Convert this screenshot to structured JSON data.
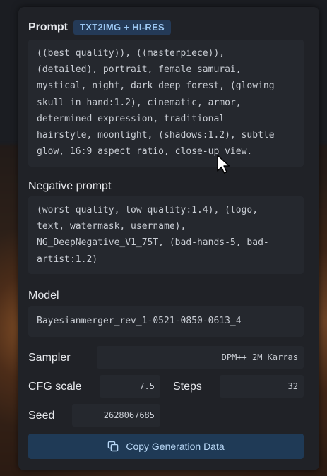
{
  "prompt": {
    "label": "Prompt",
    "badge": "TXT2IMG + HI-RES",
    "text": "((best quality)), ((masterpiece)),\n(detailed), portrait, female samurai,\nmystical, night, dark deep forest, (glowing\nskull in hand:1.2), cinematic, armor,\ndetermined expression, traditional\nhairstyle, moonlight, (shadows:1.2), subtle\nglow, 16:9 aspect ratio, close-up view."
  },
  "negative": {
    "label": "Negative prompt",
    "text": "(worst quality, low quality:1.4), (logo,\ntext, watermask, username),\nNG_DeepNegative_V1_75T, (bad-hands-5, bad-\nartist:1.2)"
  },
  "model": {
    "label": "Model",
    "value": "Bayesianmerger_rev_1-0521-0850-0613_4"
  },
  "sampler": {
    "label": "Sampler",
    "value": "DPM++ 2M Karras"
  },
  "cfg": {
    "label": "CFG scale",
    "value": "7.5"
  },
  "steps": {
    "label": "Steps",
    "value": "32"
  },
  "seed": {
    "label": "Seed",
    "value": "2628067685"
  },
  "actions": {
    "copy_label": "Copy Generation Data"
  },
  "icons": {
    "copy": "copy-icon",
    "cursor": "mouse-pointer-icon"
  },
  "colors": {
    "panel": "#202227",
    "badge_bg": "#243a57",
    "badge_text": "#9cc7f2",
    "button_bg": "#1f3a56"
  }
}
